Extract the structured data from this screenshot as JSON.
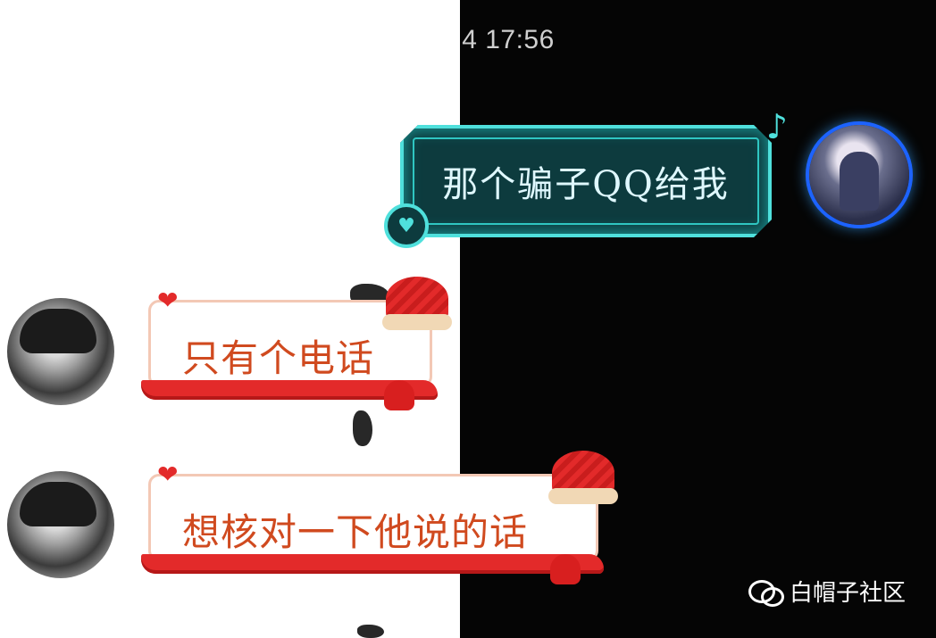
{
  "timestamp": "4 17:56",
  "messages": [
    {
      "side": "right",
      "text": "那个骗子QQ给我"
    },
    {
      "side": "left",
      "text": "只有个电话"
    },
    {
      "side": "left",
      "text": "想核对一下他说的话"
    }
  ],
  "watermark": {
    "label": "白帽子社区",
    "icon": "wechat-icon"
  },
  "colors": {
    "cyan_frame": "#4fe0dc",
    "dark_teal": "#0d3b3e",
    "red_accent": "#e32a2a",
    "text_orange": "#d04a1f"
  }
}
